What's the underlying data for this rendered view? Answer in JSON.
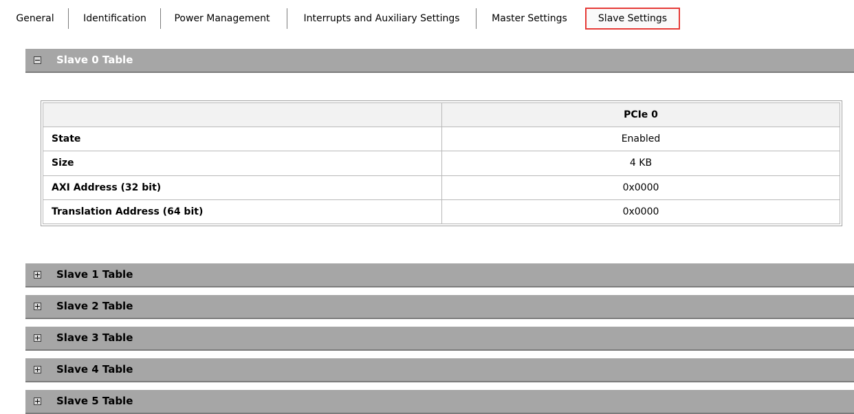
{
  "tabs": [
    {
      "label": "General"
    },
    {
      "label": "Identification"
    },
    {
      "label": "Power Management"
    },
    {
      "label": "Interrupts and Auxiliary Settings"
    },
    {
      "label": "Master Settings"
    },
    {
      "label": "Slave Settings",
      "active": true
    }
  ],
  "slave0": {
    "title": "Slave 0 Table",
    "column_header": "PCIe 0",
    "rows": [
      {
        "label": "State",
        "value": "Enabled"
      },
      {
        "label": "Size",
        "value": "4 KB"
      },
      {
        "label": "AXI Address (32 bit)",
        "value": "0x0000"
      },
      {
        "label": "Translation Address (64 bit)",
        "value": "0x0000"
      }
    ]
  },
  "sections": [
    {
      "title": "Slave 1 Table"
    },
    {
      "title": "Slave 2 Table"
    },
    {
      "title": "Slave 3 Table"
    },
    {
      "title": "Slave 4 Table"
    },
    {
      "title": "Slave 5 Table"
    }
  ],
  "colors": {
    "active_tab_border": "#e53935",
    "section_header_bg": "#a6a6a6"
  }
}
